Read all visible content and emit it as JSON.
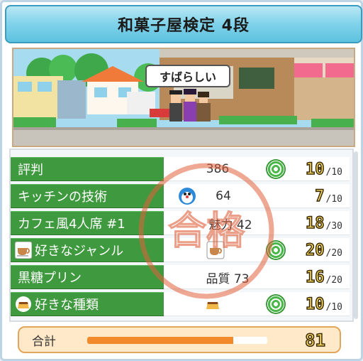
{
  "title": "和菓子屋検定 4段",
  "scene": {
    "speech": "すばらしい"
  },
  "rows": [
    {
      "label": "評判",
      "value": "386",
      "score": "10",
      "max": "/10",
      "badge": true,
      "icon": ""
    },
    {
      "label": "キッチンの技術",
      "value": "64",
      "score": "7",
      "max": "/10",
      "badge": false,
      "icon": "chef-character-icon"
    },
    {
      "label": "カフェ風4人席 #1",
      "value": "魅力 42",
      "score": "18",
      "max": "/30",
      "badge": false,
      "icon": ""
    },
    {
      "label": "好きなジャンル",
      "value": "",
      "score": "20",
      "max": "/20",
      "badge": true,
      "icon": "tea-cup-icon"
    },
    {
      "label": "黒糖プリン",
      "value": "品質 73",
      "score": "16",
      "max": "/20",
      "badge": false,
      "icon": ""
    },
    {
      "label": "好きな種類",
      "value": "",
      "score": "10",
      "max": "/10",
      "badge": true,
      "icon": "pudding-icon"
    }
  ],
  "stamp": "合格",
  "total": {
    "label": "合計",
    "score": "81",
    "progress": 0.81
  },
  "colors": {
    "row_label": "#3f9a3f",
    "stamp": "#e0603a",
    "total_fill": "#f2892a"
  }
}
